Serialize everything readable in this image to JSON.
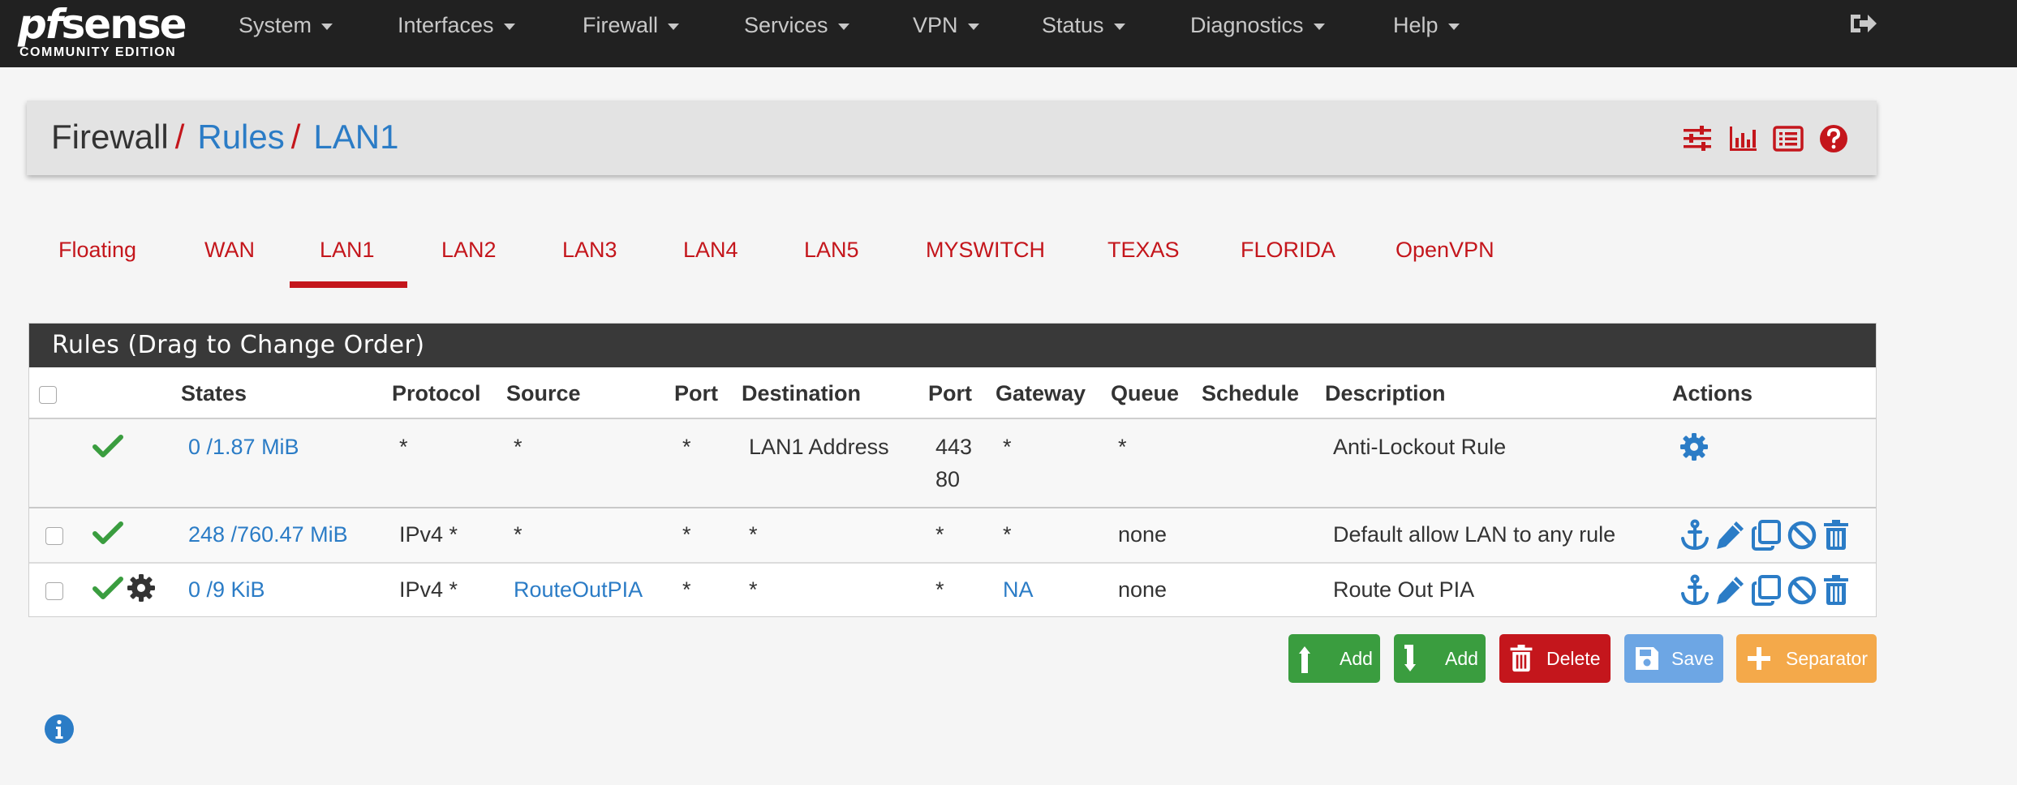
{
  "brand": {
    "name_pf": "pf",
    "name_sense": "sense",
    "edition": "COMMUNITY EDITION"
  },
  "nav": {
    "items": [
      {
        "label": "System"
      },
      {
        "label": "Interfaces"
      },
      {
        "label": "Firewall"
      },
      {
        "label": "Services"
      },
      {
        "label": "VPN"
      },
      {
        "label": "Status"
      },
      {
        "label": "Diagnostics"
      },
      {
        "label": "Help"
      }
    ],
    "logout_icon": "sign-out-icon"
  },
  "breadcrumb": {
    "items": [
      "Firewall",
      "Rules",
      "LAN1"
    ],
    "separator": "/",
    "icons": [
      "sliders-icon",
      "bar-chart-icon",
      "list-alt-icon",
      "question-circle-icon"
    ]
  },
  "tabs": {
    "items": [
      "Floating",
      "WAN",
      "LAN1",
      "LAN2",
      "LAN3",
      "LAN4",
      "LAN5",
      "MYSWITCH",
      "TEXAS",
      "FLORIDA",
      "OpenVPN"
    ],
    "active": "LAN1"
  },
  "rules": {
    "heading": "Rules (Drag to Change Order)",
    "columns": [
      "States",
      "Protocol",
      "Source",
      "Port",
      "Destination",
      "Port",
      "Gateway",
      "Queue",
      "Schedule",
      "Description",
      "Actions"
    ],
    "rows": [
      {
        "checkbox": false,
        "status_icons": [
          "check-icon"
        ],
        "states": "0 /1.87 MiB",
        "protocol": "*",
        "source": "*",
        "source_port": "*",
        "destination": "LAN1 Address",
        "dest_port_line1": "443",
        "dest_port_line2": "80",
        "gateway": "*",
        "queue": "*",
        "schedule": "",
        "description": "Anti-Lockout Rule",
        "actions": [
          "cog-icon"
        ]
      },
      {
        "checkbox": true,
        "status_icons": [
          "check-icon"
        ],
        "states": "248 /760.47 MiB",
        "protocol": "IPv4 *",
        "source": "*",
        "source_port": "*",
        "destination": "*",
        "dest_port": "*",
        "gateway": "*",
        "queue": "none",
        "schedule": "",
        "description": "Default allow LAN to any rule",
        "actions": [
          "anchor-icon",
          "pencil-icon",
          "copy-icon",
          "ban-icon",
          "trash-icon"
        ]
      },
      {
        "checkbox": true,
        "status_icons": [
          "check-icon",
          "cog-icon"
        ],
        "states": "0 /9 KiB",
        "protocol": "IPv4 *",
        "source": "RouteOutPIA",
        "source_port": "*",
        "destination": "*",
        "dest_port": "*",
        "gateway": "NA",
        "queue": "none",
        "schedule": "",
        "description": "Route Out PIA",
        "actions": [
          "anchor-icon",
          "pencil-icon",
          "copy-icon",
          "ban-icon",
          "trash-icon"
        ]
      }
    ]
  },
  "buttons": {
    "add_top": "Add",
    "add_bottom": "Add",
    "delete": "Delete",
    "save": "Save",
    "separator": "Separator"
  },
  "colors": {
    "navbar": "#212121",
    "accent_red": "#c4161c",
    "link_blue": "#2b7cc6",
    "success_green": "#3a9d3f",
    "save_blue": "#6da6e4",
    "separator_orange": "#f4a94a"
  },
  "footer": {
    "info_icon": "info-circle-icon"
  }
}
